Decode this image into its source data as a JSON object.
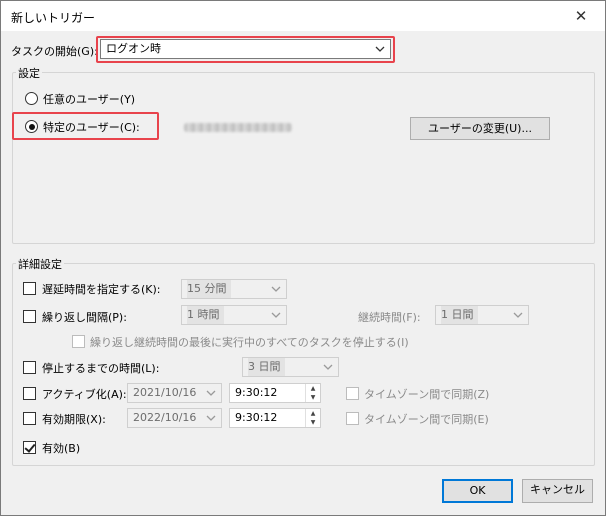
{
  "window": {
    "title": "新しいトリガー"
  },
  "task_start": {
    "label": "タスクの開始(G):",
    "value": "ログオン時"
  },
  "settings": {
    "label": "設定",
    "any_user_label": "任意のユーザー(Y)",
    "specific_user_label": "特定のユーザー(C):",
    "change_user_button": "ユーザーの変更(U)..."
  },
  "advanced": {
    "label": "詳細設定",
    "delay": {
      "label": "遅延時間を指定する(K):",
      "value": "15 分間"
    },
    "repeat": {
      "label": "繰り返し間隔(P):",
      "value": "1 時間",
      "duration_label": "継続時間(F):",
      "duration_value": "1 日間",
      "stop_all_label": "繰り返し継続時間の最後に実行中のすべてのタスクを停止する(I)"
    },
    "stop_if_longer": {
      "label": "停止するまでの時間(L):",
      "value": "3 日間"
    },
    "activate": {
      "label": "アクティブ化(A):",
      "date": "2021/10/16",
      "time": "9:30:12",
      "sync_label": "タイムゾーン間で同期(Z)"
    },
    "expire": {
      "label": "有効期限(X):",
      "date": "2022/10/16",
      "time": "9:30:12",
      "sync_label": "タイムゾーン間で同期(E)"
    },
    "enabled": {
      "label": "有効(B)",
      "checked": true
    }
  },
  "buttons": {
    "ok": "OK",
    "cancel": "キャンセル"
  },
  "colors": {
    "highlight": "#e8434c",
    "default_button_border": "#0078d7"
  }
}
